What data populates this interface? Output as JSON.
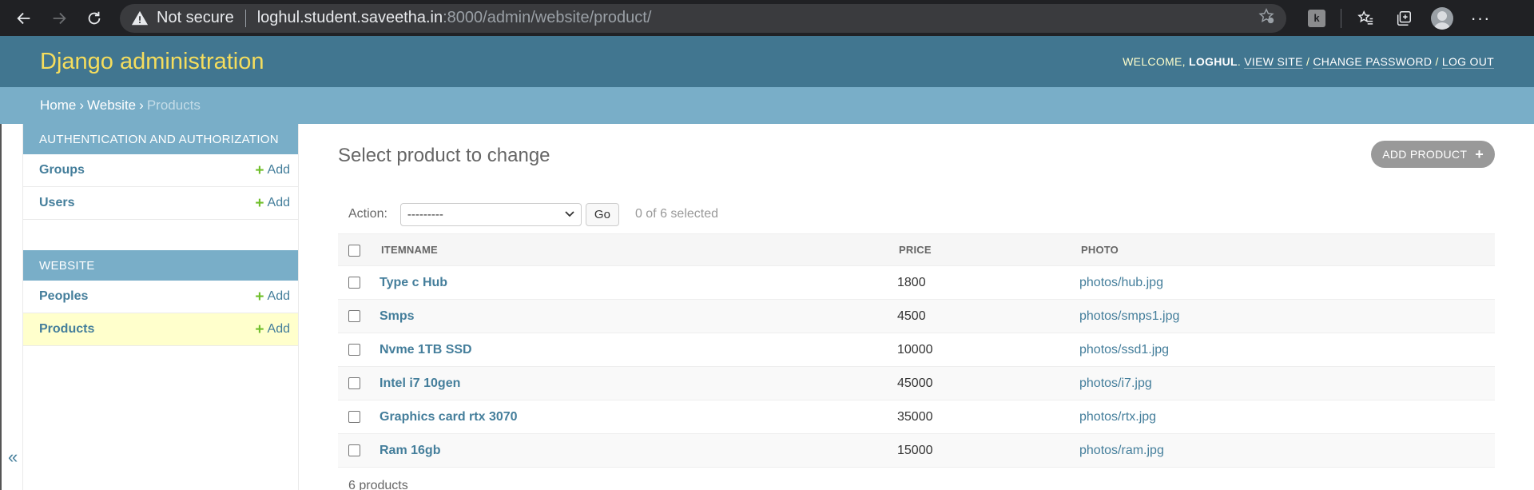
{
  "browser": {
    "security_label": "Not secure",
    "url_host": "loghul.student.saveetha.in",
    "url_rest": ":8000/admin/website/product/",
    "extension_letter": "k"
  },
  "header": {
    "site_title": "Django administration",
    "welcome": "Welcome, ",
    "username": "loghul",
    "after_user": ". ",
    "view_site": "View site",
    "change_password": "Change password",
    "log_out": "Log out",
    "slash": " / "
  },
  "breadcrumbs": {
    "home": "Home",
    "app": "Website",
    "current": "Products",
    "sep": "›"
  },
  "sidebar": {
    "modules": [
      {
        "caption": "Authentication and Authorization",
        "rows": [
          {
            "name": "Groups",
            "add": "Add"
          },
          {
            "name": "Users",
            "add": "Add"
          }
        ]
      },
      {
        "caption": "Website",
        "rows": [
          {
            "name": "Peoples",
            "add": "Add"
          },
          {
            "name": "Products",
            "add": "Add"
          }
        ]
      }
    ],
    "collapse_glyph": "«"
  },
  "content": {
    "title": "Select product to change",
    "add_button": "Add product",
    "action_label": "Action:",
    "action_value": "---------",
    "go": "Go",
    "selected": "0 of 6 selected",
    "columns": [
      "Itemname",
      "Price",
      "Photo"
    ],
    "rows": [
      {
        "item": "Type c Hub",
        "price": "1800",
        "photo": "photos/hub.jpg"
      },
      {
        "item": "Smps",
        "price": "4500",
        "photo": "photos/smps1.jpg"
      },
      {
        "item": "Nvme 1TB SSD",
        "price": "10000",
        "photo": "photos/ssd1.jpg"
      },
      {
        "item": "Intel i7 10gen",
        "price": "45000",
        "photo": "photos/i7.jpg"
      },
      {
        "item": "Graphics card rtx 3070",
        "price": "35000",
        "photo": "photos/rtx.jpg"
      },
      {
        "item": "Ram 16gb",
        "price": "15000",
        "photo": "photos/ram.jpg"
      }
    ],
    "paginator": "6 products"
  },
  "colors": {
    "header_bg": "#417690",
    "breadcrumb_bg": "#79aec8",
    "site_title": "#f5dd5d",
    "link": "#447e9b",
    "add_green": "#70bf2b",
    "current_row": "#ffffcc"
  }
}
